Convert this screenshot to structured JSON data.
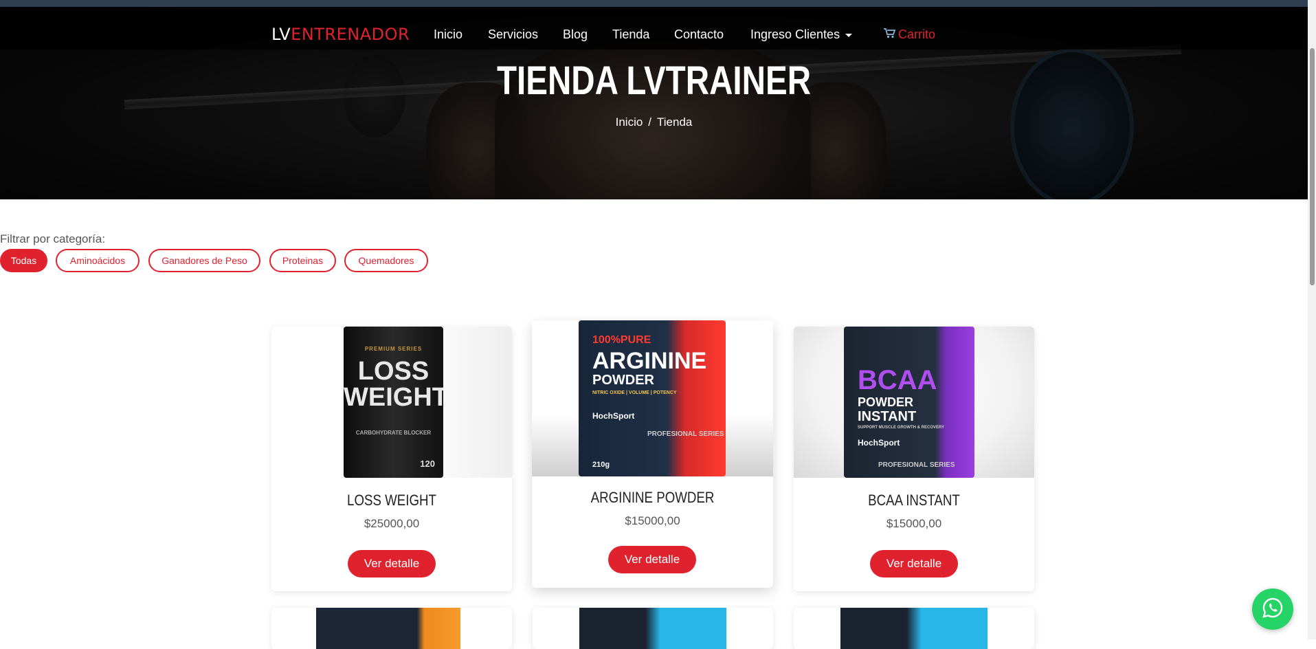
{
  "nav": {
    "brand_prefix": "LV",
    "brand_accent": "ENTRENADOR",
    "links": [
      "Inicio",
      "Servicios",
      "Blog",
      "Tienda",
      "Contacto",
      "Ingreso Clientes"
    ],
    "cart_label": "Carrito"
  },
  "hero": {
    "title": "TIENDA LVTRAINER",
    "breadcrumb": {
      "home": "Inicio",
      "separator": "/",
      "current": "Tienda"
    }
  },
  "filter": {
    "label": "Filtrar por categoría:",
    "chips": [
      "Todas",
      "Aminoácidos",
      "Ganadores de Peso",
      "Proteinas",
      "Quemadores"
    ],
    "active": "Todas"
  },
  "products": [
    {
      "name": "LOSS WEIGHT",
      "price": "$25000,00",
      "button": "Ver detalle",
      "pack": {
        "series": "PREMIUM SERIES",
        "line1": "LOSS",
        "line2": "WEIGHT",
        "note": "CARBOHYDRATE BLOCKER",
        "count": "120"
      }
    },
    {
      "name": "ARGININE POWDER",
      "price": "$15000,00",
      "button": "Ver detalle",
      "pack": {
        "brand": "100%PURE",
        "line1": "ARGININE",
        "line2": "POWDER",
        "note": "NITRIC OXIDE | VOLUME | POTENCY",
        "maker": "HochSport",
        "series": "PROFESIONAL SERIES",
        "weight": "210g"
      }
    },
    {
      "name": "BCAA INSTANT",
      "price": "$15000,00",
      "button": "Ver detalle",
      "pack": {
        "line1": "BCAA",
        "line2": "POWDER",
        "line3": "INSTANT",
        "note": "SUPPORT MUSCLE GROWTH & RECOVERY",
        "maker": "HochSport",
        "series": "PROFESIONAL SERIES"
      }
    }
  ],
  "colors": {
    "accent": "#e0222f",
    "whatsapp": "#25d366",
    "topstrip": "#2f3f52"
  }
}
